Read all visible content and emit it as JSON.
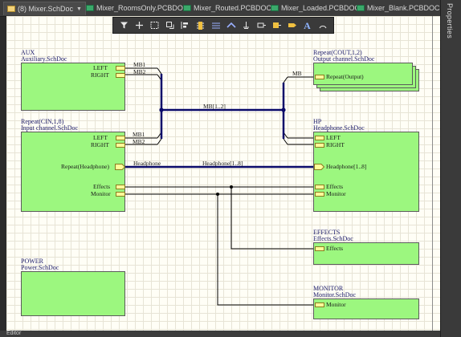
{
  "tabs": [
    {
      "label": "(8) Mixer.SchDoc",
      "type": "schematic",
      "active": true
    },
    {
      "label": "Mixer_RoomsOnly.PCBDOC",
      "type": "pcb"
    },
    {
      "label": "Mixer_Routed.PCBDOC",
      "type": "pcb"
    },
    {
      "label": "Mixer_Loaded.PCBDOC",
      "type": "pcb"
    },
    {
      "label": "Mixer_Blank.PCBDOC",
      "type": "pcb"
    }
  ],
  "right_panel": {
    "label": "Properties"
  },
  "toolbar": {
    "icons": [
      "filter-icon",
      "crosshair-icon",
      "select-rect-icon",
      "move-icon",
      "align-icon",
      "place-part-icon",
      "wire-icon",
      "bus-icon",
      "power-port-icon",
      "net-label-icon",
      "harness-icon",
      "port-icon",
      "text-icon",
      "arc-icon"
    ],
    "text_icon_glyph": "A"
  },
  "colors": {
    "sheet_fill": "#9cf77f",
    "wire": "#000000",
    "bus": "#0a0a6a",
    "canvas": "#fffef6"
  },
  "sheets": {
    "aux": {
      "designator": "AUX",
      "filename": "Auxiliary.SchDoc",
      "entries": [
        "LEFT",
        "RIGHT"
      ]
    },
    "input": {
      "designator": "Repeat(CIN,1,8)",
      "filename": "Input channel.SchDoc",
      "entries": [
        "LEFT",
        "RIGHT",
        "Repeat(Headphone)",
        "Effects",
        "Monitor"
      ]
    },
    "output": {
      "designator": "Repeat(COUT,1,2)",
      "filename": "Output channel.SchDoc",
      "entries": [
        "Repeat(Output)"
      ]
    },
    "hp": {
      "designator": "HP",
      "filename": "Headphone.SchDoc",
      "entries": [
        "LEFT",
        "RIGHT",
        "Headphone[1..8]",
        "Effects",
        "Monitor"
      ]
    },
    "effects": {
      "designator": "EFFECTS",
      "filename": "Effects.SchDoc",
      "entries": [
        "Effects"
      ]
    },
    "power": {
      "designator": "POWER",
      "filename": "Power.SchDoc"
    },
    "monitor": {
      "designator": "MONITOR",
      "filename": "Monitor.SchDoc",
      "entries": [
        "Monitor"
      ]
    }
  },
  "net_labels": {
    "mb1_a": "MB1",
    "mb2_a": "MB2",
    "mb": "MB",
    "bus": "MB[1..2]",
    "mb1_b": "MB1",
    "mb2_b": "MB2",
    "headphone": "Headphone",
    "headphone_bus": "Headphone[1..8]"
  },
  "status": {
    "tab": "Editor"
  }
}
